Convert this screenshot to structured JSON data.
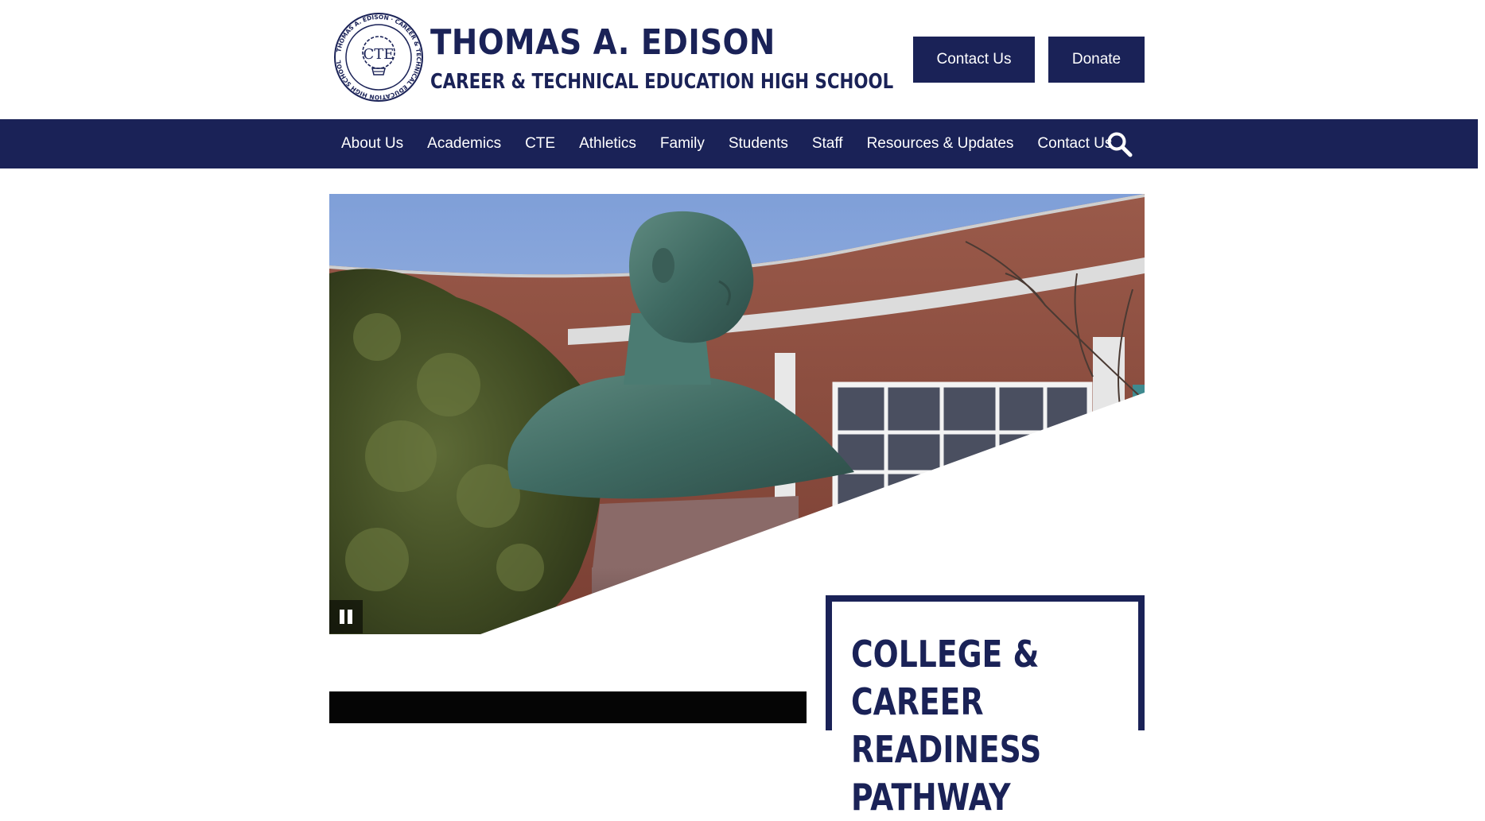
{
  "header": {
    "school_name": "THOMAS A. EDISON",
    "school_subtitle": "CAREER & TECHNICAL EDUCATION HIGH SCHOOL",
    "seal_text": "THOMAS A. EDISON · CAREER & TECHNICAL EDUCATION HIGH SCHOOL",
    "seal_monogram": "CTE",
    "contact_button": "Contact Us",
    "donate_button": "Donate"
  },
  "nav": {
    "items": [
      "About Us",
      "Academics",
      "CTE",
      "Athletics",
      "Family",
      "Students",
      "Staff",
      "Resources & Updates",
      "Contact Us"
    ]
  },
  "hero": {
    "pause_label": "Pause"
  },
  "callout": {
    "title_line1": "COLLEGE & CAREER",
    "title_line2": "READINESS PATHWAY"
  },
  "colors": {
    "brand_navy": "#1a2257",
    "white": "#ffffff"
  },
  "icons": {
    "search": "search-icon",
    "pause": "pause-icon",
    "seal": "school-seal-logo"
  }
}
